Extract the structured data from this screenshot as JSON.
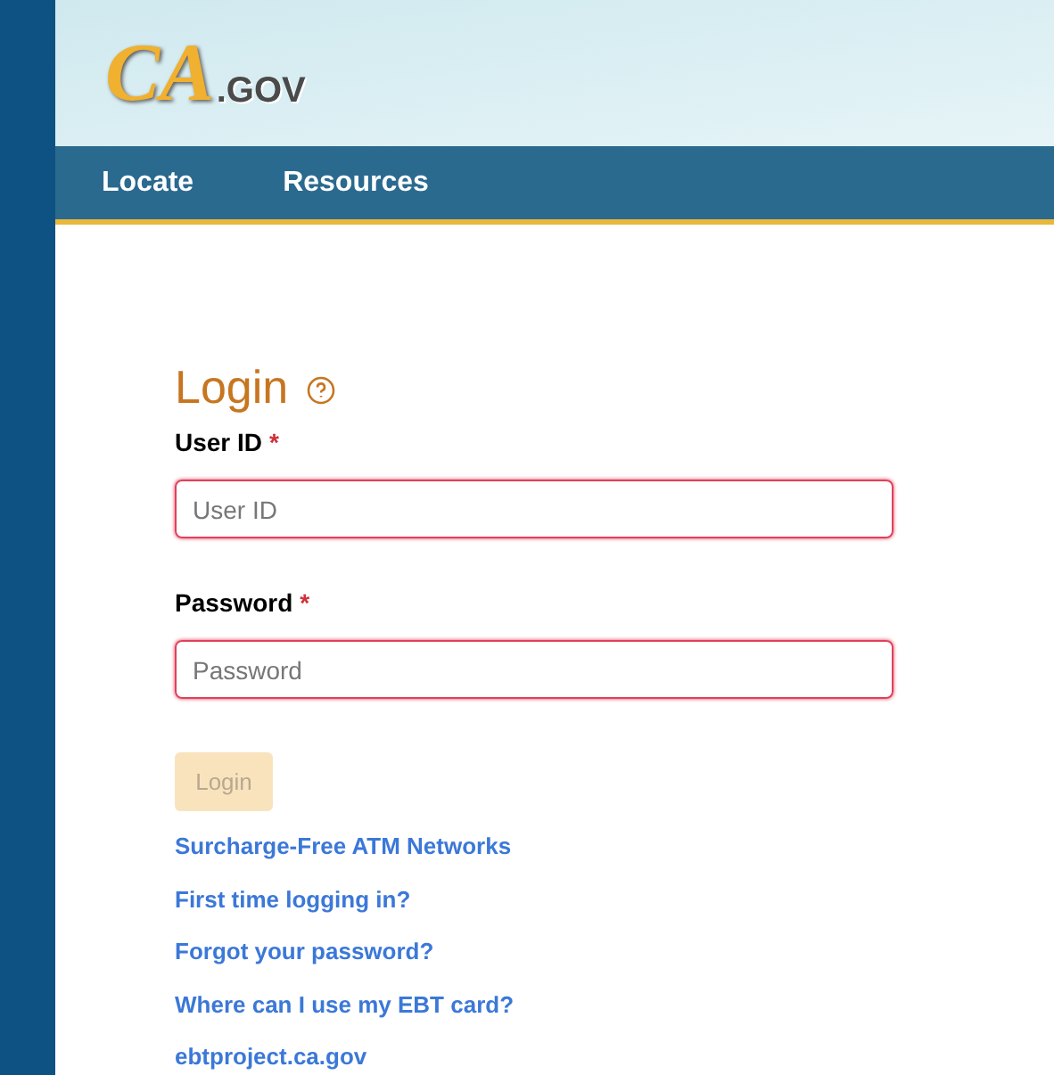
{
  "logo": {
    "mark": "CA",
    "suffix": ".GOV"
  },
  "nav": [
    {
      "label": "Locate"
    },
    {
      "label": "Resources"
    }
  ],
  "login": {
    "title": "Login",
    "fields": [
      {
        "label": "User ID",
        "required": "*",
        "placeholder": "User ID",
        "invalid": true
      },
      {
        "label": "Password",
        "required": "*",
        "placeholder": "Password",
        "invalid": true
      }
    ],
    "button": {
      "label": "Login",
      "disabled": true
    },
    "links": [
      "Surcharge-Free ATM Networks",
      "First time logging in?",
      "Forgot your password?",
      "Where can I use my EBT card?",
      "ebtproject.ca.gov"
    ]
  }
}
